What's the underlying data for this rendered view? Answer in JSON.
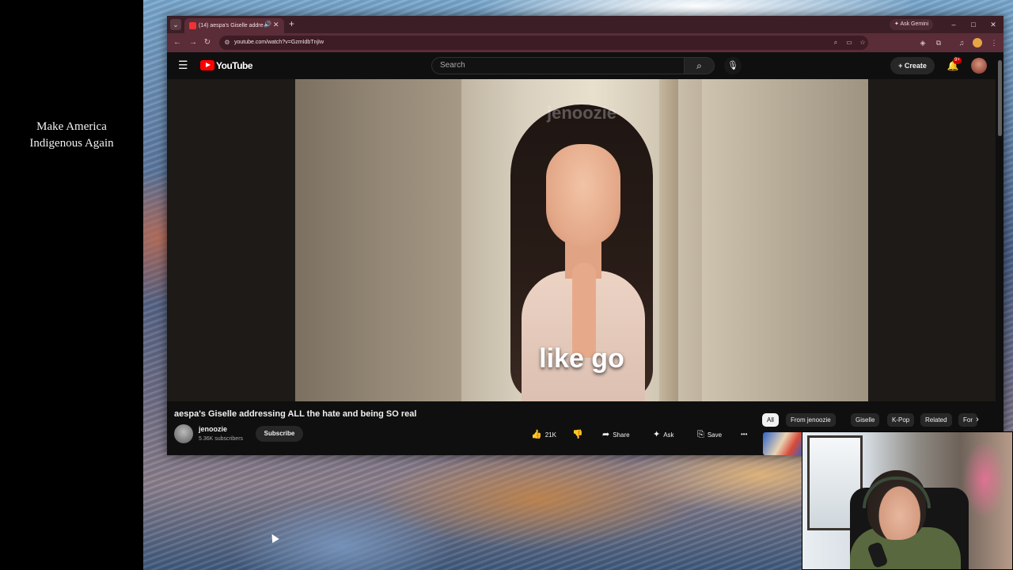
{
  "side_caption": {
    "line1": "Make America",
    "line2": "Indigenous Again"
  },
  "browser": {
    "tab": {
      "title": "(14) aespa's Giselle address"
    },
    "ask_gemini_label": "Ask Gemini",
    "url": "youtube.com/watch?v=GzmIdbTnjIw"
  },
  "youtube": {
    "wordmark": "YouTube",
    "search_placeholder": "Search",
    "create_label": "Create",
    "notification_badge": "9+",
    "video": {
      "watermark": "jenoozie",
      "caption_overlay": "like go",
      "title": "aespa's Giselle addressing ALL the hate and being SO real"
    },
    "channel": {
      "name": "jenoozie",
      "subscribers": "5.36K subscribers",
      "subscribe_label": "Subscribe"
    },
    "actions": {
      "likes": "21K",
      "share": "Share",
      "ask": "Ask",
      "save": "Save"
    },
    "chips": [
      "All",
      "From jenoozie",
      "Giselle",
      "K-Pop",
      "Related",
      "For"
    ]
  },
  "colors": {
    "tab_bar": "#3b1e26",
    "address_bar": "#5b2d38",
    "youtube_bg": "#0f0f0f",
    "youtube_red": "#ff0000"
  }
}
